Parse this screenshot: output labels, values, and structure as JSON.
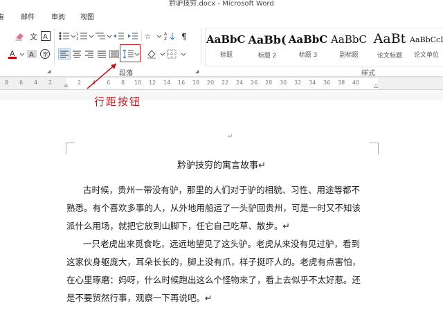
{
  "window": {
    "title": "黔驴技穷.docx - Microsoft Word"
  },
  "tabs": [
    "宙",
    "邮件",
    "审阅",
    "视图"
  ],
  "ribbon": {
    "groups": {
      "paragraph": "段落",
      "styles": "样式"
    },
    "styles": [
      {
        "sample": "AaBbC(",
        "name": "标题"
      },
      {
        "sample": "AaBb(",
        "name": "标题 2"
      },
      {
        "sample": "AaBbC",
        "name": "标题 3"
      },
      {
        "sample": "AaBbC",
        "name": "副标题"
      },
      {
        "sample": "AaBt",
        "name": "论文标题"
      },
      {
        "sample": "AaBbCcD",
        "name": "论文单位"
      }
    ],
    "font_color": "#c00000",
    "icons": [
      "eraser-icon",
      "pinyin-icon",
      "char-border-icon",
      "bullets-icon",
      "numbering-icon",
      "multilevel-icon",
      "decrease-indent-icon",
      "increase-indent-icon",
      "asian-layout-icon",
      "sort-icon",
      "show-marks-icon",
      "font-color-icon",
      "highlight-icon",
      "shading-icon",
      "align-left-icon",
      "align-center-icon",
      "align-right-icon",
      "justify-icon",
      "distributed-icon",
      "line-spacing-icon",
      "fill-icon",
      "borders-icon"
    ]
  },
  "ruler": {
    "ticks": [
      "8",
      "6",
      "4",
      "2",
      "",
      "2",
      "4",
      "6",
      "8",
      "10",
      "12",
      "14",
      "16",
      "18",
      "20",
      "22",
      "24",
      "26",
      "28",
      "30",
      "32",
      "34",
      "36",
      "38",
      "40"
    ]
  },
  "annotation": {
    "label": "行距按钮",
    "accent": "#c0181e"
  },
  "document": {
    "title": "黔驴技穷的寓言故事↵",
    "top_mark": "↵",
    "paragraphs": [
      [
        "古时候，贵州一带没有驴，那里的人们对于驴的相貌、习性、用途等都不",
        "熟悉。有个喜欢多事的人，从外地用船运了一头驴回贵州，可是一时又不知该",
        "派什么用场，就把它放到山脚下，任它自己吃草、散步。↵"
      ],
      [
        "一只老虎出来觅食吃，远远地望见了这头驴。老虎从来没有见过驴，看到",
        "这家伙身躯庞大，耳朵长长的，脚上没有爪，样子挺吓人的。老虎有点害怕，",
        "在心里琢磨：妈呀，什么时候跑出这么个怪物来了，看上去似乎不太好惹。还",
        "是不要贸然行事，观察一下再说吧。↵"
      ]
    ]
  }
}
